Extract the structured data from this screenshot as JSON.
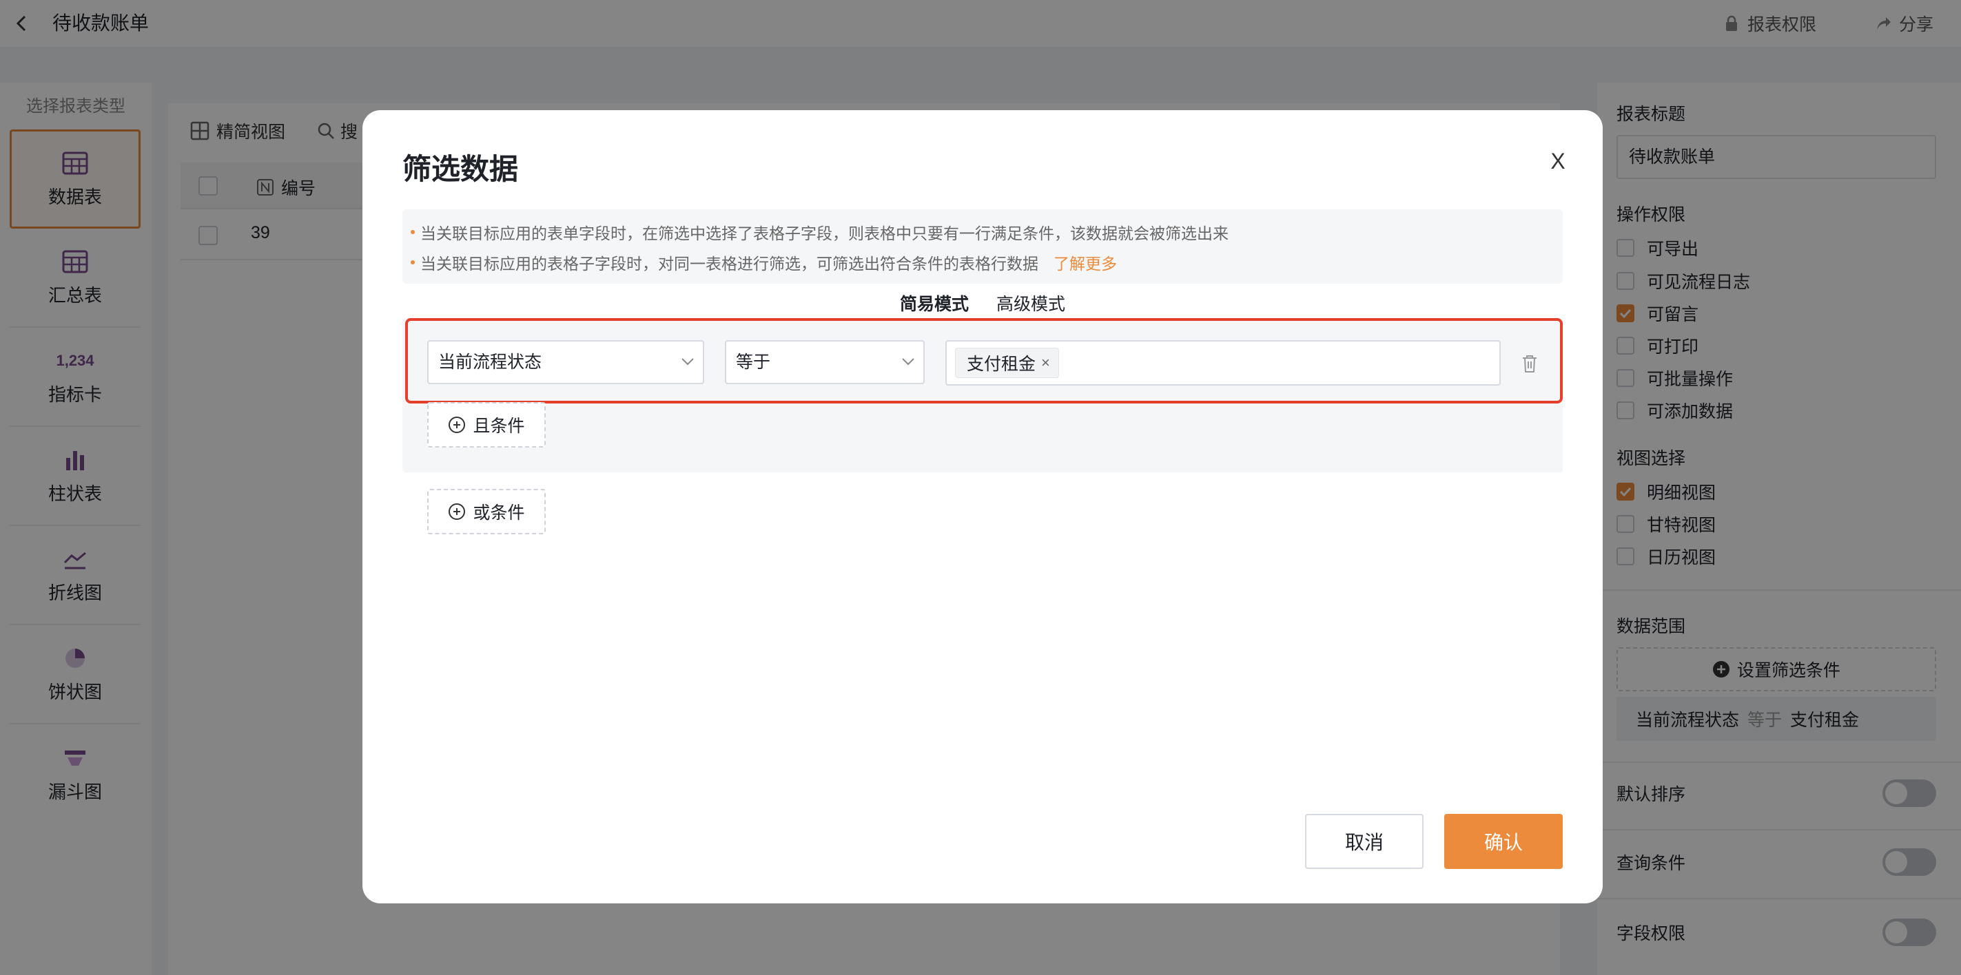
{
  "header": {
    "title": "待收款账单",
    "report_permission": "报表权限",
    "share": "分享"
  },
  "left_panel": {
    "title": "选择报表类型",
    "types": [
      {
        "label": "数据表",
        "icon": "table-icon",
        "active": true
      },
      {
        "label": "汇总表",
        "icon": "summary-table-icon"
      },
      {
        "label": "指标卡",
        "icon": "metric-card-icon",
        "icon_text": "1,234"
      },
      {
        "label": "柱状表",
        "icon": "bar-chart-icon"
      },
      {
        "label": "折线图",
        "icon": "line-chart-icon"
      },
      {
        "label": "饼状图",
        "icon": "pie-chart-icon"
      },
      {
        "label": "漏斗图",
        "icon": "funnel-chart-icon"
      }
    ]
  },
  "center": {
    "view_label": "精简视图",
    "search_label": "搜",
    "column_header": "编号",
    "row_value": "39"
  },
  "right_panel": {
    "report_title_label": "报表标题",
    "report_title_value": "待收款账单",
    "permissions_label": "操作权限",
    "permissions": [
      {
        "label": "可导出",
        "checked": false
      },
      {
        "label": "可见流程日志",
        "checked": false
      },
      {
        "label": "可留言",
        "checked": true
      },
      {
        "label": "可打印",
        "checked": false
      },
      {
        "label": "可批量操作",
        "checked": false
      },
      {
        "label": "可添加数据",
        "checked": false
      }
    ],
    "view_select_label": "视图选择",
    "views": [
      {
        "label": "明细视图",
        "checked": true
      },
      {
        "label": "甘特视图",
        "checked": false
      },
      {
        "label": "日历视图",
        "checked": false
      }
    ],
    "data_range_label": "数据范围",
    "set_filter_button": "设置筛选条件",
    "filter_summary": {
      "field": "当前流程状态",
      "operator": "等于",
      "value": "支付租金"
    },
    "default_sort_label": "默认排序",
    "query_condition_label": "查询条件",
    "field_permission_label": "字段权限"
  },
  "modal": {
    "title": "筛选数据",
    "close": "X",
    "notice_lines": [
      "当关联目标应用的表单字段时，在筛选中选择了表格子字段，则表格中只要有一行满足条件，该数据就会被筛选出来",
      "当关联目标应用的表格子字段时，对同一表格进行筛选，可筛选出符合条件的表格行数据"
    ],
    "learn_more": "了解更多",
    "tabs": [
      {
        "label": "简易模式",
        "active": true
      },
      {
        "label": "高级模式",
        "active": false
      }
    ],
    "condition": {
      "field": "当前流程状态",
      "operator": "等于",
      "values": [
        "支付租金"
      ]
    },
    "and_condition": "且条件",
    "or_condition": "或条件",
    "cancel": "取消",
    "confirm": "确认"
  },
  "colors": {
    "accent": "#ed8b3c",
    "highlight_border": "#e6402d"
  }
}
